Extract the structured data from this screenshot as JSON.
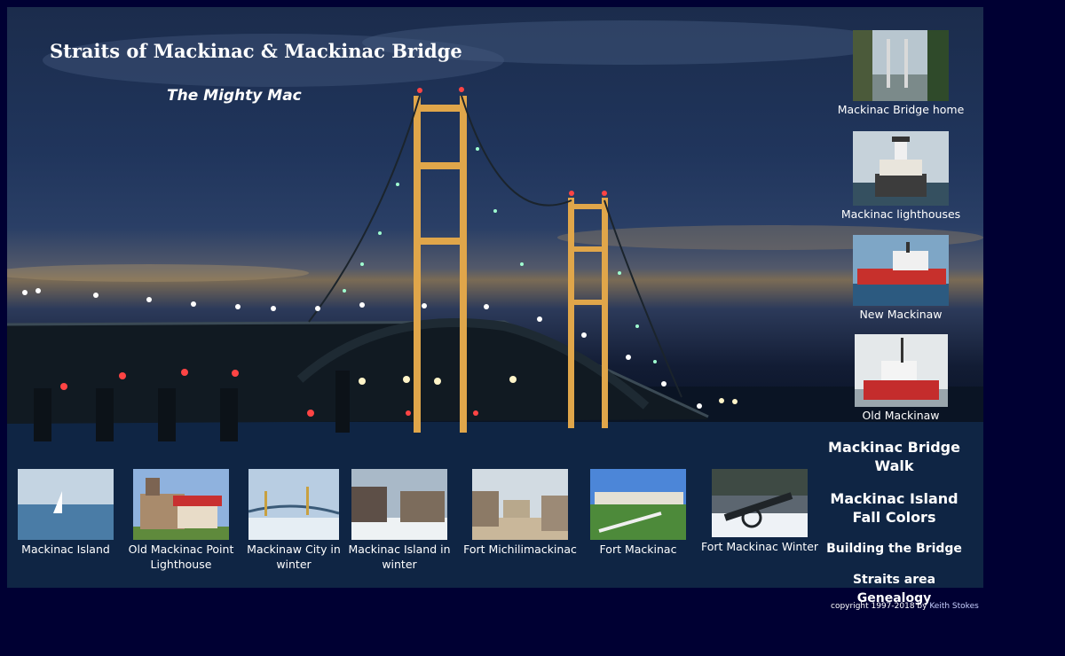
{
  "header": {
    "title": "Straits of Mackinac & Mackinac Bridge",
    "subtitle": "The Mighty Mac"
  },
  "side_nav": {
    "thumbs": [
      {
        "label": "Mackinac Bridge home",
        "icon": "bridge-photo-icon"
      },
      {
        "label": "Mackinac lighthouses",
        "icon": "lighthouse-photo-icon"
      },
      {
        "label": "New Mackinaw",
        "icon": "icebreaker-photo-icon"
      },
      {
        "label": "Old Mackinaw",
        "icon": "old-icebreaker-photo-icon"
      }
    ],
    "links": [
      "Mackinac Bridge Walk",
      "Mackinac Island Fall Colors",
      "Building the Bridge",
      "Straits area Genealogy"
    ]
  },
  "bottom_nav": [
    {
      "label": "Mackinac Island"
    },
    {
      "label": "Old Mackinac Point Lighthouse"
    },
    {
      "label": "Mackinaw City in winter"
    },
    {
      "label": "Mackinac Island in winter"
    },
    {
      "label": "Fort Michilimackinac"
    },
    {
      "label": "Fort Mackinac"
    },
    {
      "label": "Fort Mackinac Winter"
    }
  ],
  "footer": {
    "copyright": "copyright 1997-2018 by",
    "author": "Keith Stokes"
  },
  "colors": {
    "page_background": "#000033",
    "bridge_tower": "#e0a64a",
    "text": "#ffffff"
  }
}
